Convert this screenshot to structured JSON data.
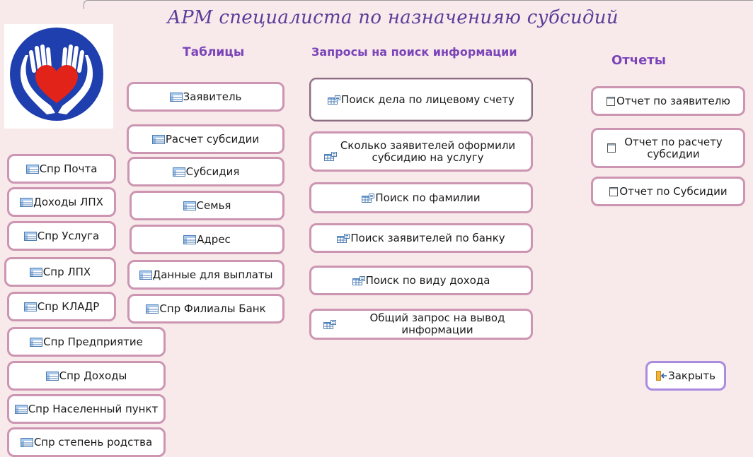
{
  "window": {
    "title": "АРМ специалиста по назначенияю субсидий"
  },
  "sections": {
    "tables": "Таблицы",
    "queries": "Запросы на поиск информации",
    "reports": "Отчеты"
  },
  "tables_column": [
    "Заявитель",
    "Расчет субсидии",
    "Субсидия",
    "Семья",
    "Адрес",
    "Данные для выплаты",
    "Спр Филиалы Банк"
  ],
  "reference_column": [
    "Спр Почта",
    "Доходы ЛПХ",
    "Спр Услуга",
    "Спр ЛПХ",
    "Спр КЛАДР",
    "Спр Предприятие",
    "Спр Доходы",
    "Спр Населенный пункт",
    "Спр степень родства"
  ],
  "queries": [
    "Поиск дела по лицевому счету",
    "Сколько заявителей оформили субсидию на услугу",
    "Поиск по фамилии",
    "Поиск заявителей по банку",
    "Поиск по виду дохода",
    "Общий запрос на вывод информации"
  ],
  "reports": [
    "Отчет по заявителю",
    "Отчет по расчету субсидии",
    "Отчет по Субсидии"
  ],
  "close_label": "Закрыть",
  "icons": {
    "logo": "heart-hands-icon",
    "table": "table-icon",
    "query": "query-icon",
    "report": "report-icon",
    "close": "exit-door-icon"
  },
  "colors": {
    "background": "#f8e9ea",
    "title": "#5a3d9a",
    "section": "#7b45b8",
    "button_border": "#cc95b1",
    "logo_blue": "#1f3fae",
    "logo_heart": "#e2231a"
  }
}
